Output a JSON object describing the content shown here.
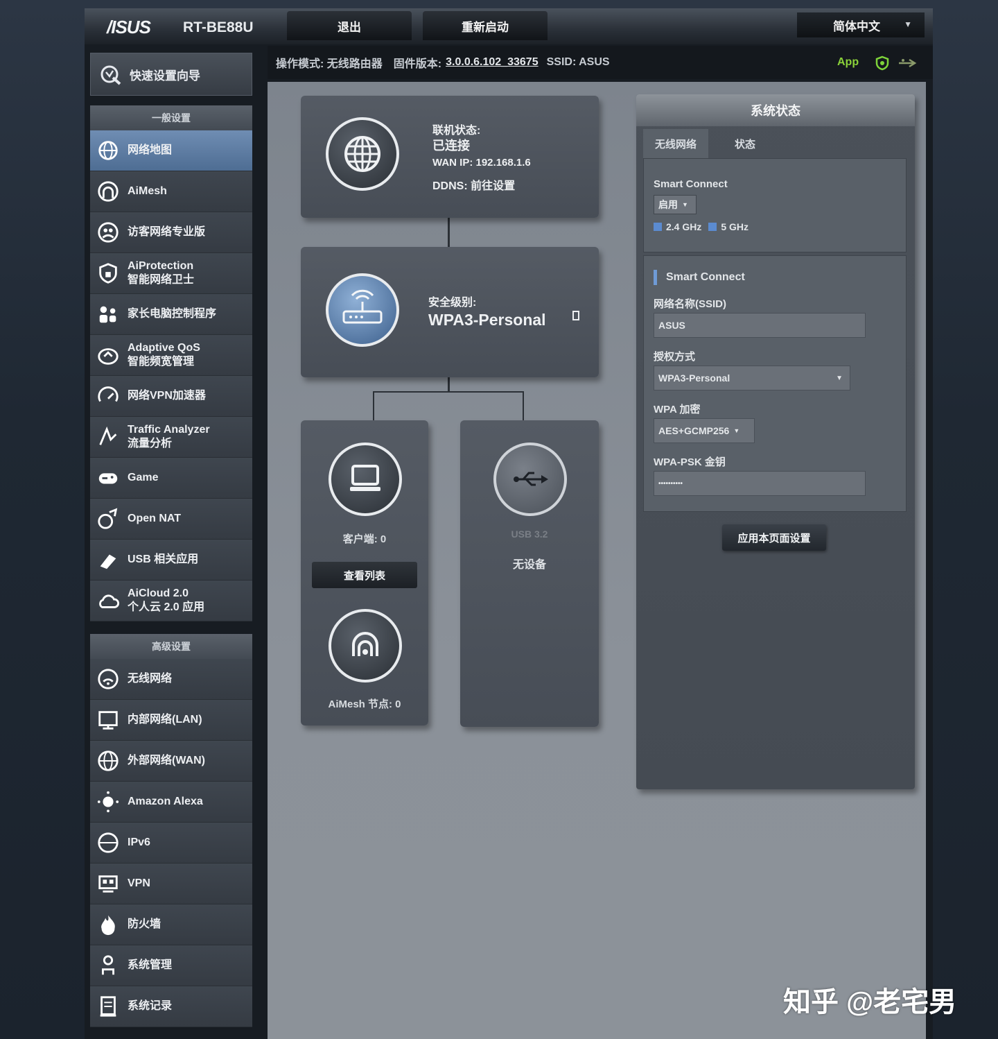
{
  "header": {
    "brand": "/ISUS",
    "model": "RT-BE88U",
    "logout_label": "退出",
    "reboot_label": "重新启动",
    "language": "简体中文"
  },
  "status_bar": {
    "op_mode": "操作模式: 无线路由器",
    "firmware_label": "固件版本:",
    "firmware_version": "3.0.0.6.102_33675",
    "ssid": "SSID: ASUS",
    "app_label": "App"
  },
  "sidebar": {
    "quick_setup": "快速设置向导",
    "general_title": "一般设置",
    "general_items": [
      {
        "label": "网络地图",
        "icon": "network-map-icon"
      },
      {
        "label": "AiMesh",
        "icon": "aimesh-icon"
      },
      {
        "label": "访客网络专业版",
        "icon": "guest-network-icon"
      },
      {
        "label": "AiProtection\n智能网络卫士",
        "icon": "aiprotection-icon"
      },
      {
        "label": "家长电脑控制程序",
        "icon": "parental-control-icon"
      },
      {
        "label": "Adaptive QoS\n智能频宽管理",
        "icon": "qos-icon"
      },
      {
        "label": "网络VPN加速器",
        "icon": "vpn-accelerator-icon"
      },
      {
        "label": "Traffic Analyzer\n流量分析",
        "icon": "traffic-analyzer-icon"
      },
      {
        "label": "Game",
        "icon": "gamepad-icon"
      },
      {
        "label": "Open NAT",
        "icon": "open-nat-icon"
      },
      {
        "label": "USB 相关应用",
        "icon": "usb-app-icon"
      },
      {
        "label": "AiCloud 2.0\n个人云 2.0 应用",
        "icon": "cloud-icon"
      }
    ],
    "advanced_title": "高级设置",
    "advanced_items": [
      {
        "label": "无线网络",
        "icon": "wireless-icon"
      },
      {
        "label": "内部网络(LAN)",
        "icon": "lan-icon"
      },
      {
        "label": "外部网络(WAN)",
        "icon": "wan-icon"
      },
      {
        "label": "Amazon Alexa",
        "icon": "alexa-icon"
      },
      {
        "label": "IPv6",
        "icon": "ipv6-icon"
      },
      {
        "label": "VPN",
        "icon": "vpn-icon"
      },
      {
        "label": "防火墙",
        "icon": "firewall-icon"
      },
      {
        "label": "系统管理",
        "icon": "admin-icon"
      },
      {
        "label": "系统记录",
        "icon": "syslog-icon"
      }
    ]
  },
  "map": {
    "internet": {
      "status_label": "联机状态:",
      "status_value": "已连接",
      "wan_ip": "WAN IP: 192.168.1.6",
      "ddns": "DDNS: 前往设置"
    },
    "router": {
      "security_label": "安全级别:",
      "security_value": "WPA3-Personal"
    },
    "clients": {
      "label": "客户端: 0",
      "button": "查看列表"
    },
    "aimesh": {
      "label": "AiMesh 节点: 0"
    },
    "usb": {
      "label": "USB 3.2",
      "status": "无设备"
    }
  },
  "system_status": {
    "title": "系统状态",
    "tabs": [
      "无线网络",
      "状态"
    ],
    "smart_connect_label": "Smart Connect",
    "smart_connect_value": "启用",
    "bands": [
      "2.4 GHz",
      "5 GHz"
    ],
    "section_title": "Smart Connect",
    "ssid_label": "网络名称(SSID)",
    "ssid_value": "ASUS",
    "auth_label": "授权方式",
    "auth_value": "WPA3-Personal",
    "wpa_label": "WPA 加密",
    "wpa_value": "AES+GCMP256",
    "psk_label": "WPA-PSK 金钥",
    "psk_value": "••••••••••",
    "apply_label": "应用本页面设置"
  },
  "watermark": "知乎 @老宅男"
}
